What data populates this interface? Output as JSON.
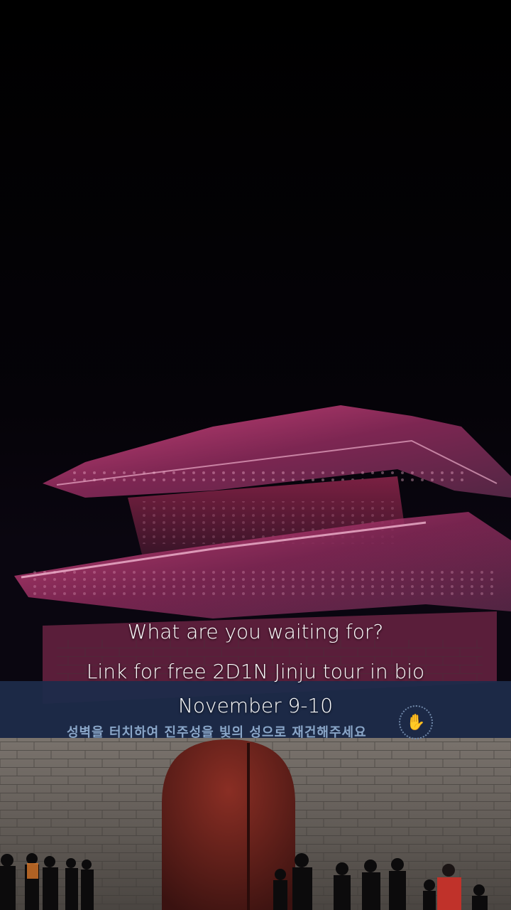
{
  "captions": {
    "line1": "What are you waiting for?",
    "line2": "Link for free 2D1N Jinju tour in bio",
    "line3": "November 9-10"
  },
  "banner": {
    "text": "성벽을 터치하여 진주성을 빛의 성으로 재건해주세요",
    "icon": "hand-icon"
  },
  "colors": {
    "sky": "#000000",
    "pavilion_glow": "#d23c7a",
    "wall": "#6f6a66",
    "banner": "#1e2b4a"
  }
}
